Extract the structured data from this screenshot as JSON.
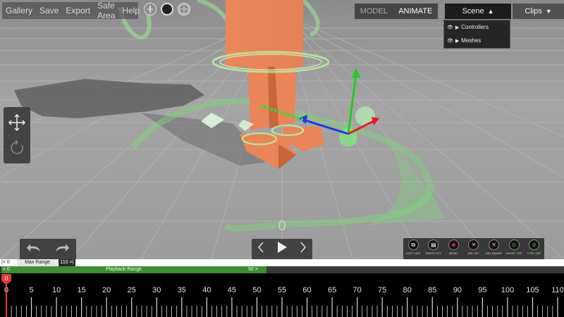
{
  "menu": {
    "items": [
      {
        "name": "menu-gallery",
        "label": "Gallery"
      },
      {
        "name": "menu-save",
        "label": "Save"
      },
      {
        "name": "menu-export",
        "label": "Export"
      },
      {
        "name": "menu-safe-area",
        "label": "Safe Area"
      },
      {
        "name": "menu-help",
        "label": "Help"
      }
    ]
  },
  "mode": {
    "model_label": "MODEL",
    "animate_label": "ANIMATE",
    "active": "ANIMATE"
  },
  "scene_panel": {
    "scene_label": "Scene",
    "clips_label": "Clips"
  },
  "outliner": {
    "items": [
      {
        "label": "Controllers"
      },
      {
        "label": "Meshes"
      }
    ]
  },
  "viewport": {
    "current_frame_display": "0",
    "gizmo_colors": {
      "x": "#e02020",
      "y": "#22cc22",
      "z": "#1a3ae0"
    },
    "character_color": "#e98557"
  },
  "key_tools": {
    "buttons": [
      {
        "name": "copy-key-button",
        "label": "COPY KEY",
        "icon": "copy-icon"
      },
      {
        "name": "paste-key-button",
        "label": "PASTE KEY",
        "icon": "paste-icon"
      },
      {
        "name": "reset-button",
        "label": "RESET",
        "icon": "reset-figure-icon"
      },
      {
        "name": "del-key-button",
        "label": "DEL KEY",
        "icon": "delete-key-figure-icon"
      },
      {
        "name": "del-range-button",
        "label": "DEL RANGE",
        "icon": "delete-range-figure-icon"
      },
      {
        "name": "ghost-off-button",
        "label": "GHOST OFF",
        "icon": "ghost-figure-icon"
      },
      {
        "name": "ctrl-off-button",
        "label": "CTRL OFF",
        "icon": "control-figure-icon"
      }
    ]
  },
  "range": {
    "start_label": "|< 0",
    "max_label": "Max Range",
    "end_label": "110 >|"
  },
  "playback": {
    "start_label": "< 0",
    "label": "Playback Range",
    "end_label": "50 >"
  },
  "timeline": {
    "current_frame": 0,
    "max_frame": 110,
    "tick_labels": [
      "0",
      "5",
      "10",
      "15",
      "20",
      "25",
      "30",
      "35",
      "40",
      "45",
      "50",
      "55",
      "60",
      "65",
      "70",
      "75",
      "80",
      "85",
      "90",
      "95",
      "100",
      "105",
      "110"
    ],
    "playhead_label": "0"
  }
}
